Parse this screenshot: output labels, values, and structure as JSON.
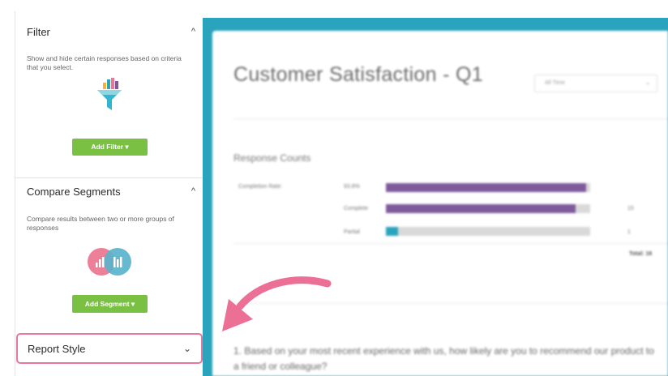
{
  "sidebar": {
    "filter": {
      "title": "Filter",
      "chevron": "^",
      "description": "Show and hide certain responses based on criteria that you select.",
      "icon": "funnel-chart-icon",
      "button_label": "Add Filter ▾"
    },
    "compare": {
      "title": "Compare Segments",
      "chevron": "^",
      "description": "Compare results between two or more groups of responses",
      "icon": "segments-chart-icon",
      "button_label": "Add Segment ▾"
    },
    "report_style": {
      "title": "Report Style",
      "chevron": "⌄"
    }
  },
  "report": {
    "title": "Customer Satisfaction - Q1",
    "time_filter": "All Time",
    "section_title": "Response Counts",
    "rows": [
      {
        "main_label": "Completion Rate:",
        "label": "93.8%",
        "fill_fraction": 0.98,
        "count": "",
        "color": "#7e5a9b"
      },
      {
        "main_label": "",
        "label": "Complete",
        "fill_fraction": 0.93,
        "count": "15",
        "color": "#7e5a9b"
      },
      {
        "main_label": "",
        "label": "Partial",
        "fill_fraction": 0.06,
        "count": "1",
        "color": "#2aa4bd"
      }
    ],
    "total": "Total: 16",
    "question": "1. Based on your most recent experience with us, how likely are you to recommend our product to a friend or colleague?"
  },
  "colors": {
    "teal": "#2aa4bd",
    "green_button": "#7ac143",
    "highlight_pink": "#e9779a",
    "purple_bar": "#7e5a9b"
  }
}
